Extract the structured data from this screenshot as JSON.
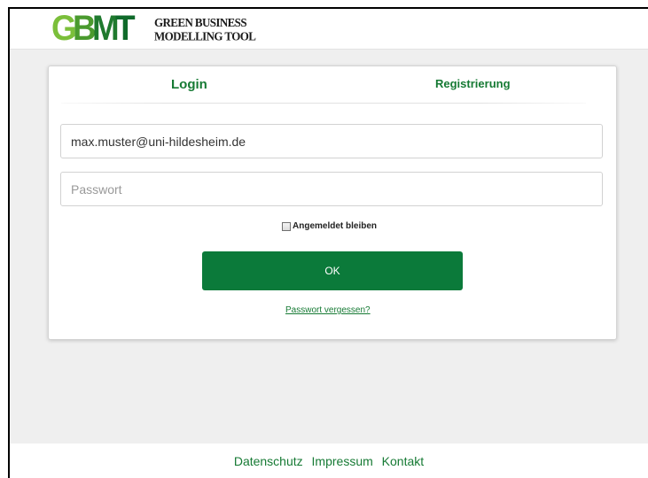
{
  "header": {
    "logo_letters": [
      {
        "char": "G",
        "color": "#7bbf3a"
      },
      {
        "char": "B",
        "color": "#4a9a2e"
      },
      {
        "char": "M",
        "color": "#1f7a2e"
      },
      {
        "char": "T",
        "color": "#0f6a2a"
      }
    ],
    "logo_line1": "GREEN BUSINESS",
    "logo_line2": "MODELLING TOOL"
  },
  "tabs": {
    "login": "Login",
    "register": "Registrierung"
  },
  "form": {
    "email_value": "max.muster@uni-hildesheim.de",
    "password_placeholder": "Passwort",
    "remember_label": "Angemeldet bleiben",
    "ok_label": "OK",
    "forgot_label": "Passwort vergessen?"
  },
  "footer": {
    "links": [
      "Datenschutz",
      "Impressum",
      "Kontakt"
    ]
  },
  "colors": {
    "accent": "#0b7a3a",
    "link": "#167a34"
  }
}
